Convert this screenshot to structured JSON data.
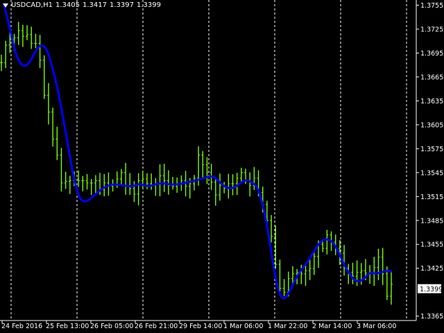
{
  "header": {
    "symbol": "USDCAD,H1",
    "open": "1.3405",
    "high": "1.3417",
    "low": "1.3397",
    "close": "1.3399"
  },
  "colors": {
    "background": "#000000",
    "bull_candle": "#7CFC00",
    "bear_candle": "#7CFC00",
    "ma_line": "#0000FF",
    "grid": "#FFFFFF",
    "axis_text": "#FFFFFF"
  },
  "chart_data": {
    "type": "line",
    "title": "",
    "xlabel": "",
    "ylabel": "",
    "x_tick_labels": [
      "24 Feb 2016",
      "25 Feb 13:00",
      "26 Feb 05:00",
      "26 Feb 21:00",
      "29 Feb 14:00",
      "1 Mar 06:00",
      "1 Mar 22:00",
      "2 Mar 14:00",
      "3 Mar 06:00"
    ],
    "y_tick_labels": [
      "1.3755",
      "1.3725",
      "1.3695",
      "1.3665",
      "1.3635",
      "1.3605",
      "1.3575",
      "1.3545",
      "1.3515",
      "1.3485",
      "1.3455",
      "1.3425",
      "1.3365"
    ],
    "y_ticks": [
      1.3755,
      1.3725,
      1.3695,
      1.3665,
      1.3635,
      1.3605,
      1.3575,
      1.3545,
      1.3515,
      1.3485,
      1.3455,
      1.3425,
      1.3365
    ],
    "ylim": [
      1.33595,
      1.37615
    ],
    "current_price_label": "1.3399",
    "current_price": 1.3399,
    "grid": "vertical dotted",
    "series": [
      {
        "kind": "price",
        "values": [
          1.3683,
          1.3705,
          1.3712,
          1.3714,
          1.3723,
          1.3716,
          1.3718,
          1.3707,
          1.3707,
          1.3686,
          1.3642,
          1.3621,
          1.3587,
          1.3567,
          1.3532,
          1.3534,
          1.3535,
          1.3537,
          1.3535,
          1.3535,
          1.3532,
          1.3532,
          1.3535,
          1.3524,
          1.3532,
          1.3528,
          1.3531,
          1.3537,
          1.3545,
          1.3529,
          1.3525,
          1.3518,
          1.3535,
          1.3537,
          1.3531,
          1.3529,
          1.3531,
          1.3541,
          1.3535,
          1.3529,
          1.3528,
          1.3531,
          1.3535,
          1.3528,
          1.3531,
          1.3538,
          1.3567,
          1.3555,
          1.3545,
          1.3533,
          1.3517,
          1.3529,
          1.3525,
          1.3531,
          1.3531,
          1.3538,
          1.3545,
          1.3535,
          1.3529,
          1.3538,
          1.352,
          1.3505,
          1.3485,
          1.3465,
          1.343,
          1.34,
          1.3395,
          1.3412,
          1.3418,
          1.342,
          1.3418,
          1.3422,
          1.3425,
          1.344,
          1.3455,
          1.345,
          1.3467,
          1.3458,
          1.345,
          1.3444,
          1.3425,
          1.342,
          1.3415,
          1.342,
          1.3422,
          1.3419,
          1.3418,
          1.3426,
          1.3439,
          1.3418,
          1.339,
          1.3405
        ]
      },
      {
        "kind": "moving_average",
        "values": [
          1.3755,
          1.3728,
          1.3697,
          1.3681,
          1.3678,
          1.3686,
          1.37,
          1.3706,
          1.3699,
          1.3676,
          1.3648,
          1.3612,
          1.3573,
          1.3535,
          1.3512,
          1.3508,
          1.3512,
          1.3518,
          1.3524,
          1.3528,
          1.353,
          1.353,
          1.3529,
          1.3528,
          1.3528,
          1.3531,
          1.3529,
          1.3528,
          1.353,
          1.3532,
          1.3531,
          1.353,
          1.353,
          1.3531,
          1.3533,
          1.3534,
          1.3536,
          1.3538,
          1.354,
          1.354,
          1.3533,
          1.3527,
          1.3525,
          1.3527,
          1.3533,
          1.3536,
          1.3533,
          1.3527,
          1.3506,
          1.3472,
          1.3426,
          1.3393,
          1.3385,
          1.3396,
          1.341,
          1.3422,
          1.343,
          1.344,
          1.3452,
          1.346,
          1.3462,
          1.3458,
          1.3447,
          1.3431,
          1.3419,
          1.341,
          1.3408,
          1.3413,
          1.342,
          1.3418,
          1.342,
          1.3422,
          1.3421
        ]
      }
    ]
  }
}
